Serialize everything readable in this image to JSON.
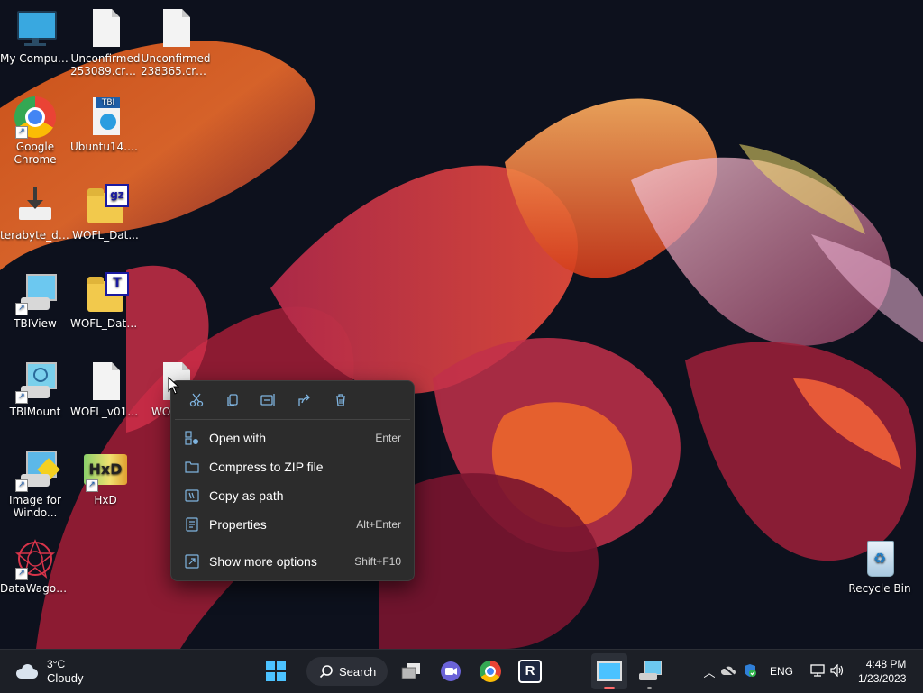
{
  "desktop": {
    "icons": [
      {
        "label": "My Computer"
      },
      {
        "label": "Unconfirmed 253089.crdo..."
      },
      {
        "label": "Unconfirmed 238365.crdo..."
      },
      {
        "label": "Google Chrome"
      },
      {
        "label": "Ubuntu14.0..."
      },
      {
        "label": "terabyte_dri..."
      },
      {
        "label": "WOFL_Dat..."
      },
      {
        "label": "TBIView"
      },
      {
        "label": "WOFL_Data...."
      },
      {
        "label": "TBIMount"
      },
      {
        "label": "WOFL_v01...."
      },
      {
        "label": "WO"
      },
      {
        "label": "Image for Windo..."
      },
      {
        "label": "HxD"
      },
      {
        "label": "DataWagon..."
      },
      {
        "label": "Recycle Bin"
      }
    ],
    "badges": {
      "tbi": "TBI",
      "gz": "gz",
      "t": "T",
      "hxd": "HxD"
    }
  },
  "context_menu": {
    "toolbar": [
      "cut-icon",
      "copy-icon",
      "rename-icon",
      "share-icon",
      "delete-icon"
    ],
    "items": [
      {
        "label": "Open with",
        "shortcut": "Enter"
      },
      {
        "label": "Compress to ZIP file",
        "shortcut": ""
      },
      {
        "label": "Copy as path",
        "shortcut": ""
      },
      {
        "label": "Properties",
        "shortcut": "Alt+Enter"
      }
    ],
    "more": {
      "label": "Show more options",
      "shortcut": "Shift+F10"
    }
  },
  "taskbar": {
    "weather": {
      "temp": "3°C",
      "condition": "Cloudy"
    },
    "search_label": "Search",
    "tray": {
      "language": "ENG",
      "time": "4:48 PM",
      "date": "1/23/2023"
    }
  },
  "colors": {
    "accent": "#4cc2ff",
    "taskbar": "#1c1f26",
    "menu": "#2c2c2c"
  }
}
